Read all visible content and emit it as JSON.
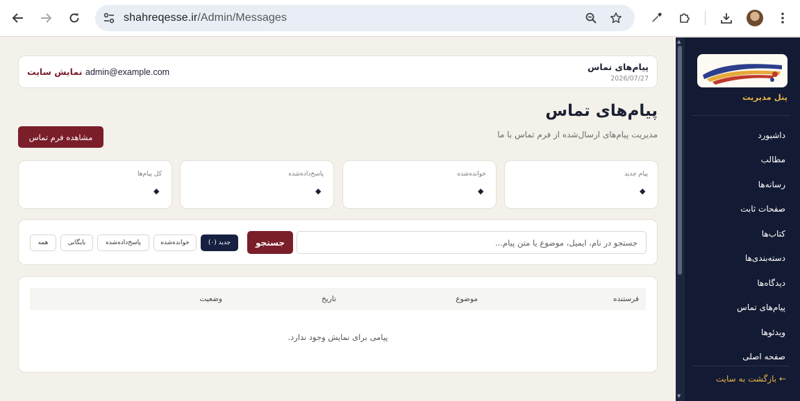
{
  "browser": {
    "url_host": "shahreqesse.ir",
    "url_path": "/Admin/Messages",
    "icons": [
      "back-arrow-icon",
      "forward-arrow-icon",
      "reload-icon",
      "site-settings-icon",
      "zoom-icon",
      "bookmark-star-icon",
      "eyedropper-icon",
      "extensions-icon",
      "download-icon",
      "profile-avatar",
      "kebab-menu-icon"
    ]
  },
  "header": {
    "title": "پیام‌های تماس",
    "date": "2026/07/27",
    "email": "admin@example.com",
    "site_link": "نمایش سایت"
  },
  "page": {
    "title": "پیام‌های تماس",
    "subtitle": "مدیریت پیام‌های ارسال‌شده از فرم تماس با ما",
    "view_form_button": "مشاهده فرم تماس"
  },
  "stats": [
    {
      "label": "پیام جدید",
      "value": "◆"
    },
    {
      "label": "خوانده‌شده",
      "value": "◆"
    },
    {
      "label": "پاسخ‌داده‌شده",
      "value": "◆"
    },
    {
      "label": "کل پیام‌ها",
      "value": "◆"
    }
  ],
  "filters": {
    "search_placeholder": "جستجو در نام، ایمیل، موضوع یا متن پیام...",
    "search_button": "جستجو",
    "tabs": [
      {
        "label": "جدید (۰)",
        "active": true
      },
      {
        "label": "خوانده‌شده",
        "active": false
      },
      {
        "label": "پاسخ‌داده‌شده",
        "active": false
      },
      {
        "label": "بایگانی",
        "active": false
      },
      {
        "label": "همه",
        "active": false
      }
    ]
  },
  "table": {
    "columns": [
      "فرستنده",
      "موضوع",
      "تاریخ",
      "وضعیت"
    ],
    "empty_message": "پیامی برای نمایش وجود ندارد."
  },
  "sidebar": {
    "caption": "پنل مدیریت",
    "items": [
      "داشبورد",
      "مطالب",
      "رسانه‌ها",
      "صفحات ثابت",
      "کتاب‌ها",
      "دسته‌بندی‌ها",
      "دیدگاه‌ها",
      "پیام‌های تماس",
      "ویدئوها",
      "صفحه اصلی"
    ],
    "back_link": "← بازگشت به سایت"
  },
  "colors": {
    "accent": "#7a1e2a",
    "sidebar_bg": "#131a33",
    "sidebar_accent": "#e7b649",
    "active_tab": "#172040",
    "page_bg": "#f4f1eb"
  }
}
